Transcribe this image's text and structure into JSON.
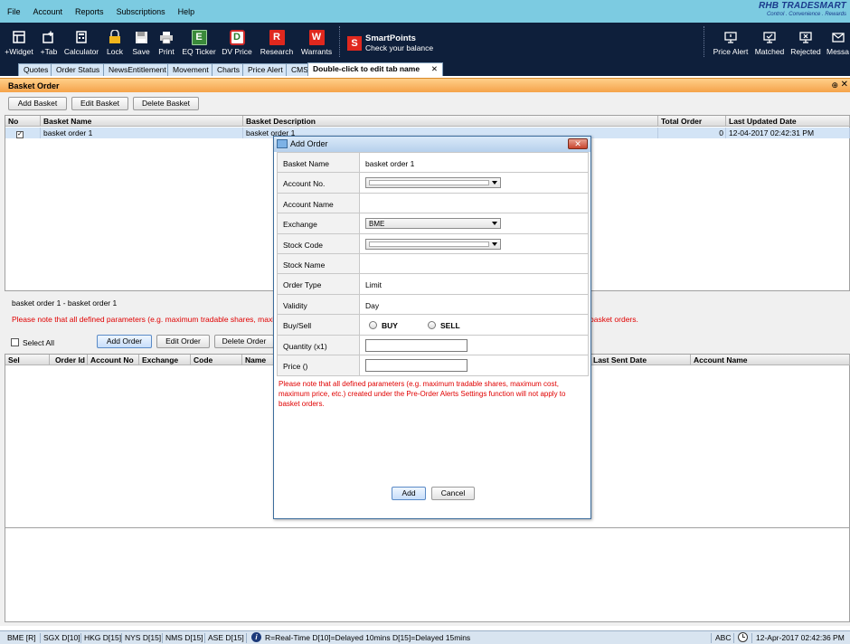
{
  "menu": [
    "File",
    "Account",
    "Reports",
    "Subscriptions",
    "Help"
  ],
  "brand": {
    "name": "RHB TRADESMART",
    "tagline": "Control . Convenience . Rewards"
  },
  "toolbar": {
    "widget": "+Widget",
    "tab": "+Tab",
    "calculator": "Calculator",
    "lock": "Lock",
    "save": "Save",
    "print": "Print",
    "eq_ticker": "EQ Ticker",
    "dv_price": "DV Price",
    "research": "Research",
    "warrants": "Warrants",
    "eq_letter": "E",
    "dv_letter": "D",
    "r_letter": "R",
    "w_letter": "W",
    "smartpoints_title": "SmartPoints",
    "smartpoints_sub": "Check your balance",
    "smartpoints_letter": "S",
    "price_alert": "Price Alert",
    "matched": "Matched",
    "rejected": "Rejected",
    "messages": "Messa"
  },
  "tabs": [
    "Quotes",
    "Order Status",
    "NewsEntitlement",
    "Movement",
    "Charts",
    "Price Alert",
    "CMS",
    "Double-click to edit tab name"
  ],
  "tab_close": "✕",
  "panel": {
    "title": "Basket Order",
    "pin": "⊕",
    "close": "✕",
    "add_basket": "Add Basket",
    "edit_basket": "Edit Basket",
    "delete_basket": "Delete Basket",
    "basket_columns": [
      "No",
      "Basket Name",
      "Basket Description",
      "Total Order",
      "Last Updated Date"
    ],
    "basket_rows": [
      {
        "checked": "✓",
        "name": "basket order 1",
        "description": "basket order 1",
        "total": "0",
        "updated": "12-04-2017 02:42:31 PM"
      }
    ],
    "selected_basket": "basket order 1 - basket order 1",
    "warning": "Please note that all defined parameters (e.g. maximum tradable shares, maximum cost, maximum price, etc.) created under the Pre-Order Alerts Settings function will not apply to basket orders.",
    "warning_left": "Please note that all defined parameters (e.g. maximum tradable shares, maximum",
    "warning_right": "basket orders.",
    "select_all": "Select All",
    "add_order": "Add Order",
    "edit_order": "Edit Order",
    "delete_order": "Delete Order",
    "order_columns_left": [
      "Sel",
      "Order Id",
      "Account No",
      "Exchange",
      "Code",
      "Name"
    ],
    "order_columns_right": [
      "Last Sent Date",
      "Account Name"
    ]
  },
  "modal": {
    "title": "Add Order",
    "close": "✕",
    "fields": {
      "basket_name_label": "Basket Name",
      "basket_name_value": "basket order 1",
      "account_no_label": "Account No.",
      "account_name_label": "Account Name",
      "exchange_label": "Exchange",
      "exchange_value": "BME",
      "stock_code_label": "Stock Code",
      "stock_name_label": "Stock Name",
      "order_type_label": "Order Type",
      "order_type_value": "Limit",
      "validity_label": "Validity",
      "validity_value": "Day",
      "buysell_label": "Buy/Sell",
      "buy": "BUY",
      "sell": "SELL",
      "quantity_label": "Quantity (x1)",
      "price_label": "Price ()"
    },
    "note": "Please note that all defined parameters (e.g. maximum tradable shares, maximum cost, maximum price, etc.) created under the Pre-Order Alerts Settings function will not apply to basket orders.",
    "add": "Add",
    "cancel": "Cancel"
  },
  "status": {
    "markets": [
      "BME [R]",
      "SGX D[10]",
      "HKG D[15]",
      "NYS D[15]",
      "NMS D[15]",
      "ASE D[15]"
    ],
    "info_glyph": "i",
    "legend": "R=Real-Time   D[10]=Delayed 10mins   D[15]=Delayed 15mins",
    "abc": "ABC",
    "datetime": "12-Apr-2017 02:42:36 PM"
  }
}
